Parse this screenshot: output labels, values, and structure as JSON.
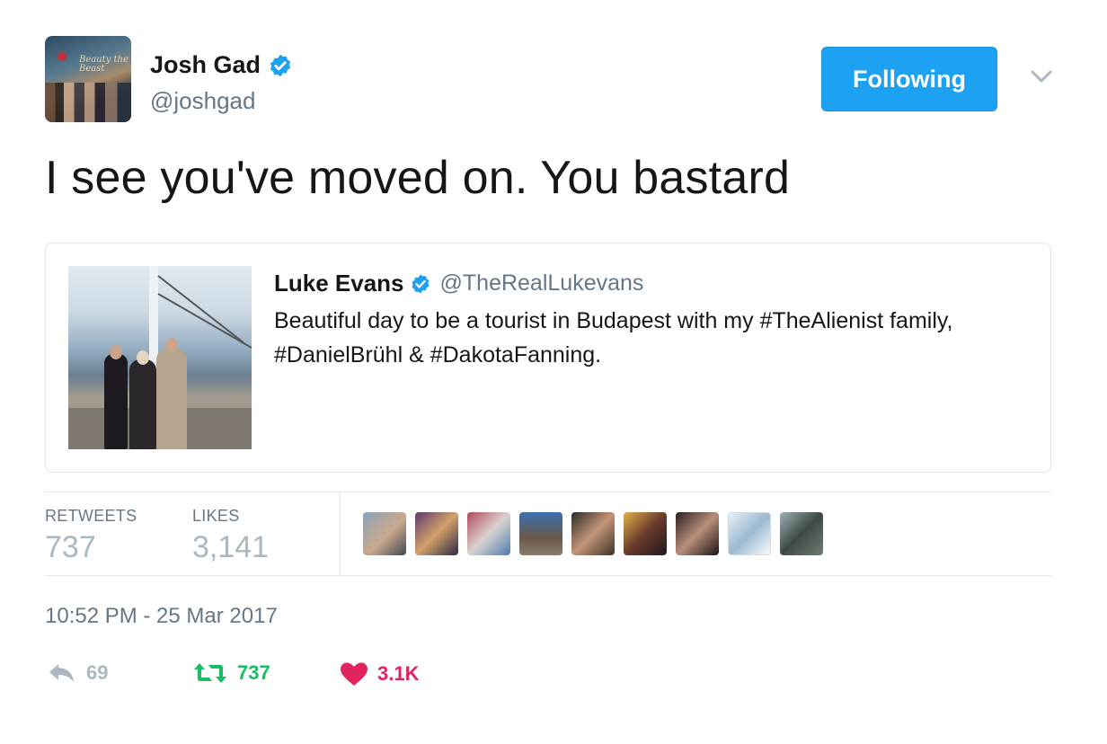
{
  "author": {
    "name": "Josh Gad",
    "handle": "@joshgad",
    "avatar_logo_text": "Beauty the Beast"
  },
  "follow_button": {
    "label": "Following"
  },
  "tweet": {
    "text": "I see you've moved on. You bastard"
  },
  "quoted_tweet": {
    "name": "Luke Evans",
    "handle": "@TheRealLukevans",
    "text": "Beautiful day to be a tourist in Budapest with my #TheAlienist family,  #DanielBrühl & #DakotaFanning."
  },
  "stats": {
    "retweets_label": "RETWEETS",
    "retweets_value": "737",
    "likes_label": "LIKES",
    "likes_value": "3,141"
  },
  "timestamp": "10:52 PM - 25 Mar 2017",
  "actions": {
    "reply_count": "69",
    "retweet_count": "737",
    "like_count": "3.1K"
  },
  "colors": {
    "accent": "#1da1f2",
    "retweet": "#17bf63",
    "like": "#e0245e",
    "muted": "#657786"
  },
  "icons": [
    "verified-badge-icon",
    "chevron-down-icon",
    "reply-icon",
    "retweet-icon",
    "heart-icon"
  ]
}
